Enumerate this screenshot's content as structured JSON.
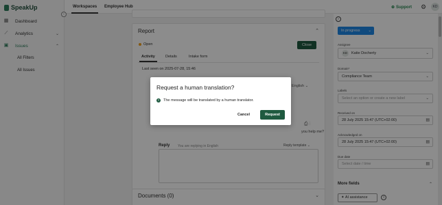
{
  "app": {
    "name": "SpeakUp"
  },
  "sidebar": {
    "items": [
      {
        "label": "Dashboard",
        "icon": "grid-icon"
      },
      {
        "label": "Analytics",
        "icon": "chart-icon"
      },
      {
        "label": "Issues",
        "icon": "issues-icon"
      }
    ],
    "sub_items": [
      "All Filters",
      "All Issues"
    ]
  },
  "header": {
    "tabs": [
      "Workspaces",
      "Employee Hub"
    ],
    "support": "Support",
    "avatar": "KD"
  },
  "report": {
    "title": "Report",
    "status": "Open",
    "close_label": "Close",
    "tabs": [
      "Activity",
      "Details",
      "Intake form"
    ],
    "last_seen": "Last seen on 2025-07-28, 15:46",
    "language": "English",
    "help_text": "you help me?",
    "reply_label": "Reply",
    "reply_hint": "You are replying in English",
    "reply_template": "Reply template"
  },
  "documents": {
    "title": "Documents (0)"
  },
  "right_panel": {
    "status_button": "In progress",
    "assignee_label": "Assignee",
    "assignee_initials": "KD",
    "assignee_name": "Katie Docherty",
    "domain_label": "Domain*",
    "domain_value": "Compliance Team",
    "labels_label": "Labels",
    "labels_placeholder": "Select an option or create a new label",
    "received_label": "Received on",
    "received_value": "28 July 2025 15:47 (UTC+02:00)",
    "ack_label": "Acknowledged on",
    "ack_value": "28 July 2025 15:47 (UTC+02:00)",
    "due_label": "Due date",
    "due_placeholder": "Select date / time",
    "more_fields": "More fields",
    "ai_assistance": "AI assistance"
  },
  "dialog": {
    "title": "Request a human translation?",
    "message": "The message will be translated by a human translator.",
    "cancel": "Cancel",
    "request": "Request"
  },
  "colors": {
    "primary_green": "#1f5a40",
    "status_blue": "#1e88e5",
    "open_dot": "#f0a020"
  }
}
